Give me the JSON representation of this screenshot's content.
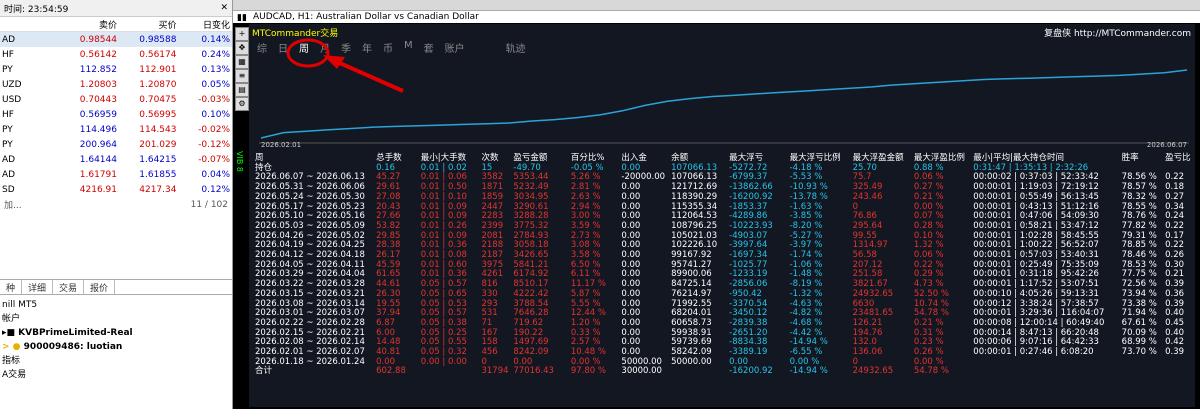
{
  "market_watch": {
    "title": "时间: 23:54:59",
    "headers": [
      "",
      "卖价",
      "买价",
      "日变化"
    ],
    "rows": [
      {
        "sym": "AD",
        "bid": "0.98544",
        "ask": "0.98588",
        "chg": "0.14%",
        "bc": "red",
        "ac": "blu",
        "cc": "blu"
      },
      {
        "sym": "HF",
        "bid": "0.56142",
        "ask": "0.56174",
        "chg": "0.24%",
        "bc": "red",
        "ac": "red",
        "cc": "blu"
      },
      {
        "sym": "PY",
        "bid": "112.852",
        "ask": "112.901",
        "chg": "0.13%",
        "bc": "blu",
        "ac": "red",
        "cc": "blu"
      },
      {
        "sym": "UZD",
        "bid": "1.20803",
        "ask": "1.20870",
        "chg": "0.05%",
        "bc": "red",
        "ac": "red",
        "cc": "blu"
      },
      {
        "sym": "USD",
        "bid": "0.70443",
        "ask": "0.70475",
        "chg": "-0.03%",
        "bc": "red",
        "ac": "red",
        "cc": "red"
      },
      {
        "sym": "HF",
        "bid": "0.56959",
        "ask": "0.56995",
        "chg": "0.10%",
        "bc": "blu",
        "ac": "red",
        "cc": "blu"
      },
      {
        "sym": "PY",
        "bid": "114.496",
        "ask": "114.543",
        "chg": "-0.02%",
        "bc": "blu",
        "ac": "red",
        "cc": "red"
      },
      {
        "sym": "PY",
        "bid": "200.964",
        "ask": "201.029",
        "chg": "-0.12%",
        "bc": "blu",
        "ac": "red",
        "cc": "red"
      },
      {
        "sym": "AD",
        "bid": "1.64144",
        "ask": "1.64215",
        "chg": "-0.07%",
        "bc": "blu",
        "ac": "blu",
        "cc": "red"
      },
      {
        "sym": "AD",
        "bid": "1.61791",
        "ask": "1.61855",
        "chg": "0.04%",
        "bc": "red",
        "ac": "blu",
        "cc": "blu"
      },
      {
        "sym": "SD",
        "bid": "4216.91",
        "ask": "4217.34",
        "chg": "0.12%",
        "bc": "red",
        "ac": "red",
        "cc": "blu"
      }
    ],
    "add_label": "加...",
    "count": "11 / 102",
    "tabs": [
      "种",
      "详细",
      "交易",
      "报价"
    ]
  },
  "navigator": {
    "items": [
      "nill MT5",
      "帐户",
      "KVBPrimeLimited-Real",
      "900009486: luotian",
      "指标",
      "A交易"
    ]
  },
  "chart": {
    "title": "AUDCAD, H1:  Australian Dollar vs Canadian Dollar",
    "brand_left": "MTCommander交易",
    "brand_right": "复盘侠 http://MTCommander.com",
    "tabs": [
      "综",
      "日",
      "周",
      "月",
      "季",
      "年",
      "币",
      "M",
      "套",
      "账户",
      "轨迹"
    ],
    "date_start": "2026.02.01",
    "date_end": "2026.06.07",
    "side_label": "VIB 8",
    "equity": [
      0,
      0.08,
      0.1,
      0.12,
      0.14,
      0.16,
      0.17,
      0.18,
      0.19,
      0.2,
      0.21,
      0.22,
      0.25,
      0.27,
      0.3,
      0.34,
      0.4,
      0.48,
      0.54,
      0.58,
      0.61,
      0.63,
      0.65,
      0.67,
      0.69,
      0.71,
      0.73,
      0.75,
      0.78,
      0.8,
      0.82,
      0.84,
      0.86,
      0.87,
      0.88,
      0.89,
      0.9,
      0.91,
      0.92,
      0.94,
      0.96,
      1.0
    ]
  },
  "table": {
    "headers": [
      "周",
      "总手数",
      "最小|大手数",
      "次数",
      "盈亏金额",
      "百分比%",
      "出入金",
      "余额",
      "最大浮亏",
      "最大浮亏比例",
      "最大浮盈金额",
      "最大浮盈比例",
      "最小|平均|最大持仓时间",
      "胜率",
      "盈亏比"
    ],
    "hold": [
      "持仓",
      "0.16",
      "0.01 | 0.02",
      "15",
      "-49.70",
      "-0.05 %",
      "0.00",
      "107066.13",
      "-5272.72",
      "-4.18 %",
      "25.70",
      "0.88 %",
      "0:31:47 | 1:35:13 | 2:32:26",
      "",
      ""
    ],
    "rows": [
      [
        "2026.06.07 ~ 2026.06.13",
        "45.27",
        "0.01 | 0.06",
        "3582",
        "5353.44",
        "5.26 %",
        "-20000.00",
        "107066.13",
        "-6799.37",
        "-5.53 %",
        "75.7",
        "0.06 %",
        "00:00:02 | 0:37:03 | 52:33:42",
        "78.56 %",
        "0.22"
      ],
      [
        "2026.05.31 ~ 2026.06.06",
        "29.61",
        "0.01 | 0.50",
        "1871",
        "5232.49",
        "2.81 %",
        "0.00",
        "121712.69",
        "-13862.66",
        "-10.93 %",
        "325.49",
        "0.27 %",
        "00:00:01 | 1:19:03 | 72:19:12",
        "78.57 %",
        "0.18"
      ],
      [
        "2026.05.24 ~ 2026.05.30",
        "27.08",
        "0.01 | 0.10",
        "1859",
        "3034.95",
        "2.63 %",
        "0.00",
        "118390.29",
        "-16200.92",
        "-13.78 %",
        "243.46",
        "0.21 %",
        "00:00:01 | 0:55:49 | 56:13:45",
        "78.32 %",
        "0.27"
      ],
      [
        "2026.05.17 ~ 2026.05.23",
        "20.43",
        "0.01 | 0.09",
        "2447",
        "3290.61",
        "2.94 %",
        "0.00",
        "115355.34",
        "-1853.37",
        "-1.63 %",
        "0",
        "0.00 %",
        "00:00:01 | 0:43:13 | 51:12:16",
        "78.55 %",
        "0.34"
      ],
      [
        "2026.05.10 ~ 2026.05.16",
        "27.66",
        "0.01 | 0.09",
        "2283",
        "3288.28",
        "3.00 %",
        "0.00",
        "112064.53",
        "-4289.86",
        "-3.85 %",
        "76.86",
        "0.07 %",
        "00:00:01 | 0:47:06 | 54:09:30",
        "78.76 %",
        "0.24"
      ],
      [
        "2026.05.03 ~ 2026.05.09",
        "53.82",
        "0.01 | 0.26",
        "2399",
        "3775.32",
        "3.59 %",
        "0.00",
        "108796.25",
        "-10223.93",
        "-8.20 %",
        "295.64",
        "0.28 %",
        "00:00:01 | 0:58:21 | 53:47:12",
        "77.82 %",
        "0.22"
      ],
      [
        "2026.04.26 ~ 2026.05.02",
        "29.85",
        "0.01 | 0.09",
        "2081",
        "2784.93",
        "2.73 %",
        "0.00",
        "105021.03",
        "-4903.07",
        "-5.27 %",
        "99.55",
        "0.10 %",
        "00:00:01 | 1:02:28 | 58:45:55",
        "79.31 %",
        "0.17"
      ],
      [
        "2026.04.19 ~ 2026.04.25",
        "28.38",
        "0.01 | 0.36",
        "2188",
        "3058.18",
        "3.08 %",
        "0.00",
        "102226.10",
        "-3997.64",
        "-3.97 %",
        "1314.97",
        "1.32 %",
        "00:00:01 | 1:00:22 | 56:52:07",
        "78.85 %",
        "0.22"
      ],
      [
        "2026.04.12 ~ 2026.04.18",
        "26.17",
        "0.01 | 0.08",
        "2187",
        "3426.65",
        "3.58 %",
        "0.00",
        "99167.92",
        "-1697.34",
        "-1.74 %",
        "56.58",
        "0.06 %",
        "00:00:01 | 0:57:03 | 53:40:31",
        "78.46 %",
        "0.26"
      ],
      [
        "2026.04.05 ~ 2026.04.11",
        "45.59",
        "0.01 | 0.60",
        "3975",
        "5841.21",
        "6.50 %",
        "0.00",
        "95741.27",
        "-1025.77",
        "-1.06 %",
        "207.12",
        "0.22 %",
        "00:00:01 | 0:25:49 | 75:35:09",
        "78.53 %",
        "0.30"
      ],
      [
        "2026.03.29 ~ 2026.04.04",
        "61.65",
        "0.01 | 0.36",
        "4261",
        "6174.92",
        "6.11 %",
        "0.00",
        "89900.06",
        "-1233.19",
        "-1.48 %",
        "251.58",
        "0.29 %",
        "00:00:01 | 0:31:18 | 95:42:26",
        "77.75 %",
        "0.21"
      ],
      [
        "2026.03.22 ~ 2026.03.28",
        "44.61",
        "0.05 | 0.57",
        "816",
        "8510.17",
        "11.17 %",
        "0.00",
        "84725.14",
        "-2856.06",
        "-8.19 %",
        "3821.67",
        "4.73 %",
        "00:00:01 | 1:17:52 | 53:07:51",
        "72.56 %",
        "0.39"
      ],
      [
        "2026.03.15 ~ 2026.03.21",
        "26.30",
        "0.05 | 0.65",
        "330",
        "4222.42",
        "5.87 %",
        "0.00",
        "76214.97",
        "-950.42",
        "-1.32 %",
        "24932.65",
        "52.50 %",
        "00:00:10 | 4:05:26 | 59:13:31",
        "73.94 %",
        "0.36"
      ],
      [
        "2026.03.08 ~ 2026.03.14",
        "19.55",
        "0.05 | 0.53",
        "293",
        "3788.54",
        "5.55 %",
        "0.00",
        "71992.55",
        "-3370.54",
        "-4.63 %",
        "6630",
        "10.74 %",
        "00:00:12 | 3:38:24 | 57:38:57",
        "73.38 %",
        "0.39"
      ],
      [
        "2026.03.01 ~ 2026.03.07",
        "37.94",
        "0.05 | 0.57",
        "531",
        "7646.28",
        "12.44 %",
        "0.00",
        "68204.01",
        "-3450.12",
        "-4.82 %",
        "23481.65",
        "54.78 %",
        "00:00:01 | 3:29:36 | 116:04:07",
        "71.94 %",
        "0.40"
      ],
      [
        "2026.02.22 ~ 2026.02.28",
        "6.87",
        "0.05 | 0.38",
        "71",
        "719.62",
        "1.20 %",
        "0.00",
        "60658.73",
        "-2839.38",
        "-4.68 %",
        "126.21",
        "0.21 %",
        "00:00:08 | 12:00:14 | 60:49:40",
        "67.61 %",
        "0.45"
      ],
      [
        "2026.02.15 ~ 2026.02.21",
        "6.00",
        "0.05 | 0.25",
        "167",
        "190.22",
        "0.33 %",
        "0.00",
        "59938.91",
        "-2651.20",
        "-4.42 %",
        "194.76",
        "0.31 %",
        "00:00:14 | 8:47:13 | 66:20:48",
        "70.09 %",
        "0.40"
      ],
      [
        "2026.02.08 ~ 2026.02.14",
        "14.48",
        "0.05 | 0.55",
        "158",
        "1497.69",
        "2.57 %",
        "0.00",
        "59739.69",
        "-8834.38",
        "-14.94 %",
        "132.0",
        "0.23 %",
        "00:00:06 | 9:07:16 | 64:42:33",
        "68.99 %",
        "0.42"
      ],
      [
        "2026.02.01 ~ 2026.02.07",
        "40.81",
        "0.05 | 0.32",
        "456",
        "8242.09",
        "10.48 %",
        "0.00",
        "58242.09",
        "-3389.19",
        "-6.55 %",
        "136.06",
        "0.26 %",
        "00:00:01 | 0:27:46 | 6:08:20",
        "73.70 %",
        "0.39"
      ],
      [
        "2026.01.18 ~ 2026.01.24",
        "0.00",
        "0.00 | 0.00",
        "0",
        "0.00",
        "0.00 %",
        "50000.00",
        "50000.00",
        "0.00",
        "0.00 %",
        "0",
        "0.00 %",
        "",
        "",
        ""
      ]
    ],
    "total": [
      "合计",
      "602.88",
      "",
      "31794",
      "77016.43",
      "97.80 %",
      "30000.00",
      "",
      "-16200.92",
      "-14.94 %",
      "24932.65",
      "54.78 %",
      "",
      "",
      ""
    ]
  }
}
